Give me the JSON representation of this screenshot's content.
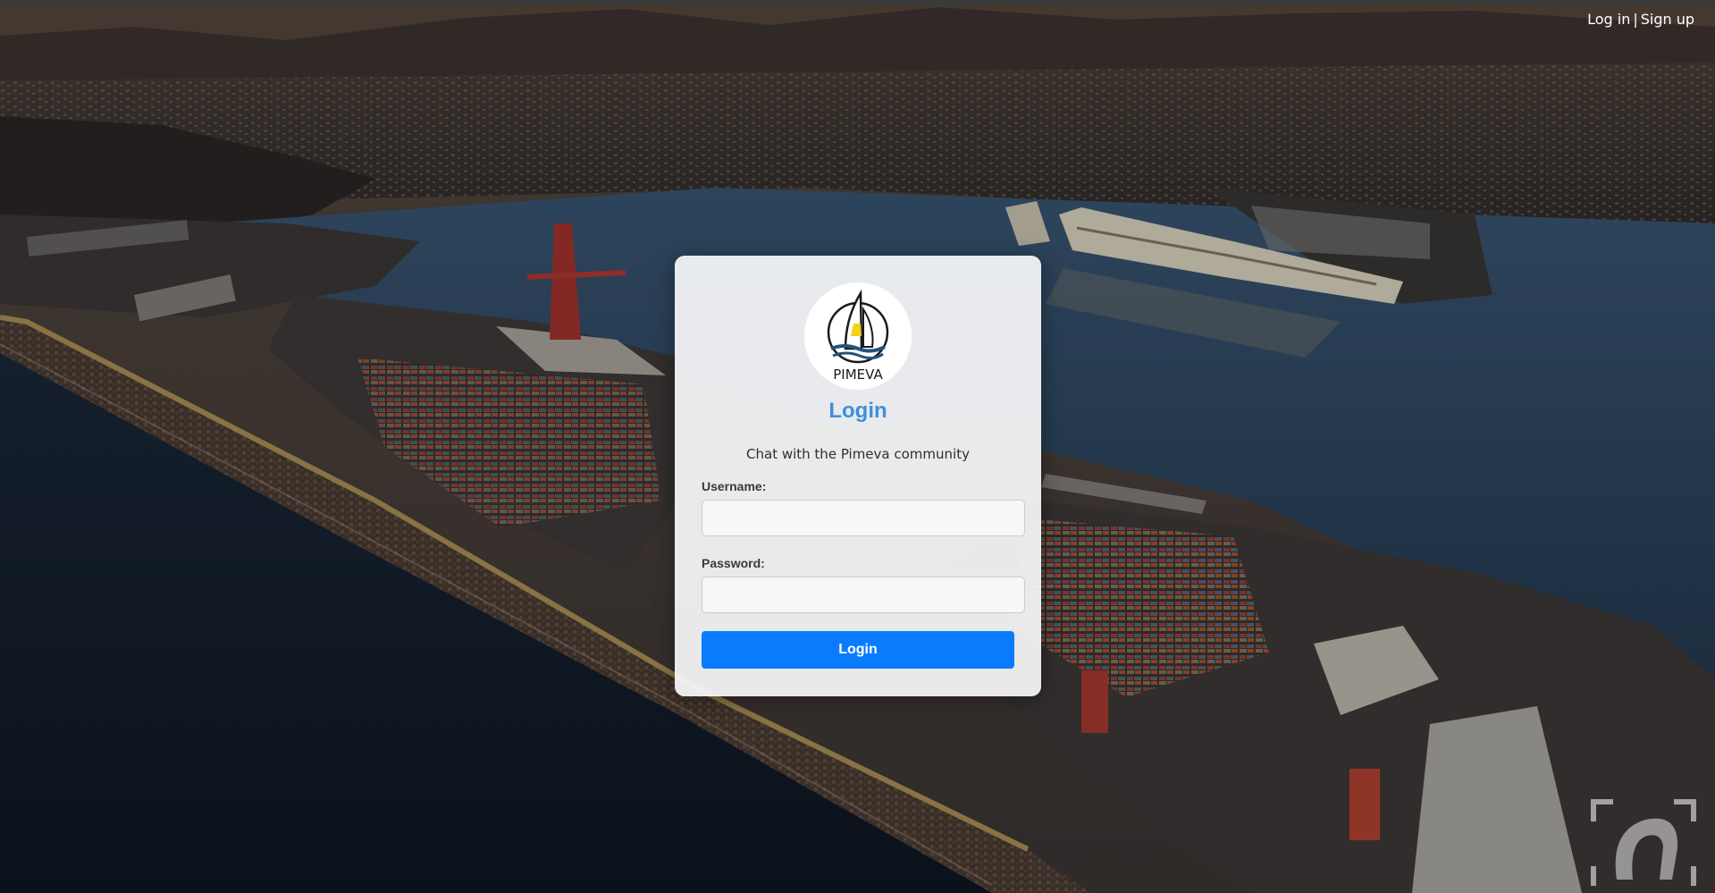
{
  "nav": {
    "login_link": "Log in",
    "separator": "|",
    "signup_link": "Sign up"
  },
  "card": {
    "logo_text": "PIMEVA",
    "title": "Login",
    "subtitle": "Chat with the Pimeva community",
    "username_label": "Username:",
    "username_value": "",
    "password_label": "Password:",
    "password_value": "",
    "submit_label": "Login"
  },
  "colors": {
    "accent": "#0a7bfd",
    "title": "#3d8fe0"
  },
  "icons": {
    "logo": "sailboat-logo",
    "watermark": "camera-frame-watermark"
  }
}
